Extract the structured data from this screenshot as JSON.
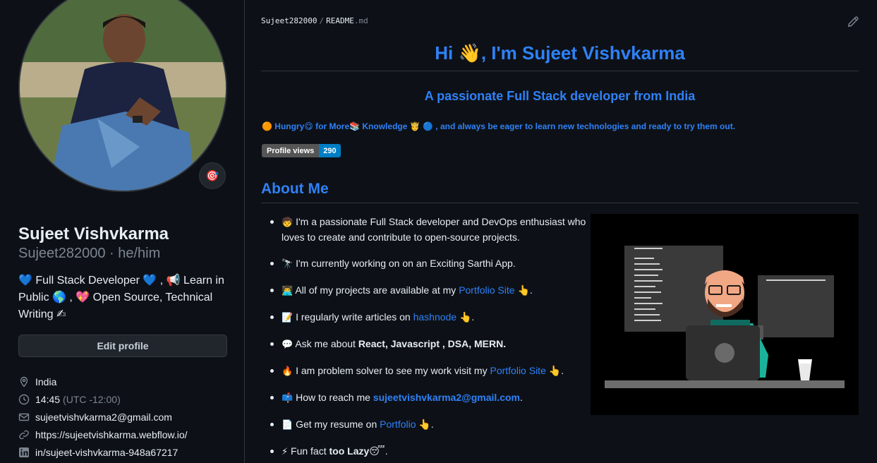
{
  "profile": {
    "name": "Sujeet Vishvkarma",
    "login": "Sujeet282000 · he/him",
    "status_emoji": "🎯",
    "bio": "💙 Full Stack Developer 💙 , 📢 Learn in Public 🌎 , 💖 Open Source, Technical Writing ✍",
    "edit_label": "Edit profile",
    "details": {
      "location": "India",
      "time": "14:45",
      "timezone": "(UTC -12:00)",
      "email": "sujeetvishvkarma2@gmail.com",
      "website": "https://sujeetvishkarma.webflow.io/",
      "linkedin": "in/sujeet-vishvkarma-948a67217"
    }
  },
  "readme": {
    "path_owner": "Sujeet282000",
    "path_sep": "/",
    "path_file": "README",
    "path_ext": ".md",
    "title": "Hi 👋, I'm Sujeet Vishvkarma",
    "subtitle": "A passionate Full Stack developer from India",
    "tagline": "🟠 Hungry😋 for More📚 Knowledge 🤴 🔵 , and always be eager to learn new technologies and ready to try them out.",
    "badge_label": "Profile views",
    "badge_value": "290",
    "about_heading": "About Me",
    "items": [
      {
        "icon": "🧒",
        "text": "I'm a passionate Full Stack developer and DevOps enthusiast who loves to create and contribute to open-source projects."
      },
      {
        "icon": "🔭",
        "text": "I'm currently working on on an Exciting Sarthi App."
      },
      {
        "icon": "👨‍💻",
        "pre": "All of my projects are available at my ",
        "link": "Portfolio Site",
        "post": " 👆."
      },
      {
        "icon": "📝",
        "pre": "I regularly write articles on ",
        "link": "hashnode",
        "post": " 👆."
      },
      {
        "icon": "💬",
        "pre": "Ask me about ",
        "bold": "React, Javascript , DSA, MERN."
      },
      {
        "icon": "🔥",
        "pre": "I am problem solver to see my work visit my ",
        "link": "Portfolio Site",
        "post": " 👆."
      },
      {
        "icon": "📫",
        "pre": "How to reach me ",
        "link_bold": "sujeetvishvkarma2@gmail.com",
        "post": "."
      },
      {
        "icon": "📄",
        "pre": "Get my resume on ",
        "link": "Portfolio",
        "post": " 👆."
      },
      {
        "icon": "⚡",
        "pre": "Fun fact ",
        "bold": "too Lazy",
        "post": "😴."
      }
    ]
  },
  "colors": {
    "background": "#0d1117",
    "accent": "#2f81f7",
    "muted": "#7d8590",
    "badge_value_bg": "#007ec6"
  }
}
